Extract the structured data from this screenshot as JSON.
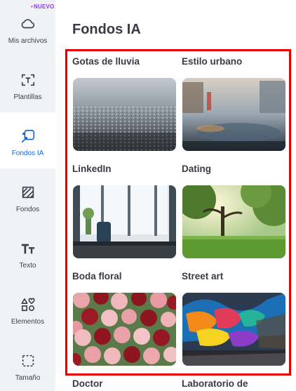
{
  "sidebar": {
    "items": [
      {
        "label": "Mis archivos",
        "icon": "cloud-icon",
        "badge": "NUEVO"
      },
      {
        "label": "Plantillas",
        "icon": "templates-icon"
      },
      {
        "label": "Fondos IA",
        "icon": "ai-backgrounds-icon",
        "active": true
      },
      {
        "label": "Fondos",
        "icon": "backgrounds-icon"
      },
      {
        "label": "Texto",
        "icon": "text-icon"
      },
      {
        "label": "Elementos",
        "icon": "elements-icon"
      },
      {
        "label": "Tamaño",
        "icon": "resize-icon"
      }
    ]
  },
  "panel": {
    "title": "Fondos IA",
    "cards": [
      {
        "label": "Gotas de lluvia",
        "image": "rain-drops"
      },
      {
        "label": "Estilo urbano",
        "image": "urban-street"
      },
      {
        "label": "LinkedIn",
        "image": "office"
      },
      {
        "label": "Dating",
        "image": "park"
      },
      {
        "label": "Boda floral",
        "image": "roses"
      },
      {
        "label": "Street art",
        "image": "graffiti"
      },
      {
        "label": "Doctor",
        "image": ""
      },
      {
        "label": "Laboratorio de",
        "image": ""
      }
    ]
  },
  "colors": {
    "accent": "#1465d8",
    "highlight": "#e60000",
    "badge": "#8b3de8"
  }
}
